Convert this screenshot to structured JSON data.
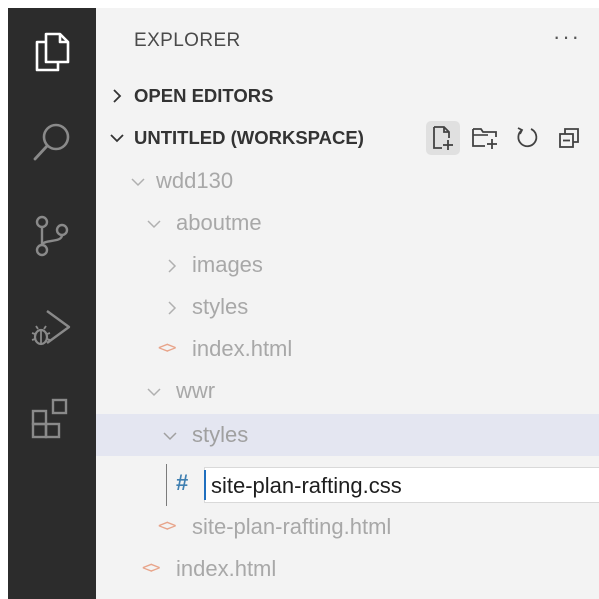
{
  "activity_bar": {
    "items": [
      {
        "name": "explorer-icon"
      },
      {
        "name": "search-icon"
      },
      {
        "name": "source-control-icon"
      },
      {
        "name": "run-debug-icon"
      },
      {
        "name": "extensions-icon"
      }
    ]
  },
  "explorer": {
    "title": "EXPLORER",
    "more": "···",
    "sections": {
      "open_editors": "OPEN EDITORS",
      "workspace": "UNTITLED (WORKSPACE)"
    },
    "toolbar": [
      "new-file-icon",
      "new-folder-icon",
      "refresh-icon",
      "collapse-all-icon"
    ],
    "tree": {
      "wdd130": "wdd130",
      "aboutme": "aboutme",
      "images": "images",
      "styles_aboutme": "styles",
      "index_aboutme": "index.html",
      "wwr": "wwr",
      "styles_wwr": "styles",
      "rename_value": "site-plan-rafting.css",
      "css_glyph": "#",
      "html_glyph": "<>",
      "site_plan_html": "site-plan-rafting.html",
      "index_wdd": "index.html"
    }
  },
  "colors": {
    "activity_bar_bg": "#2c2c2c",
    "sidebar_bg": "#f3f3f3",
    "selected_row": "#e4e6f1",
    "html_icon": "#e8a48a",
    "css_icon": "#3f7fb1",
    "caret": "#1f6fbf"
  }
}
